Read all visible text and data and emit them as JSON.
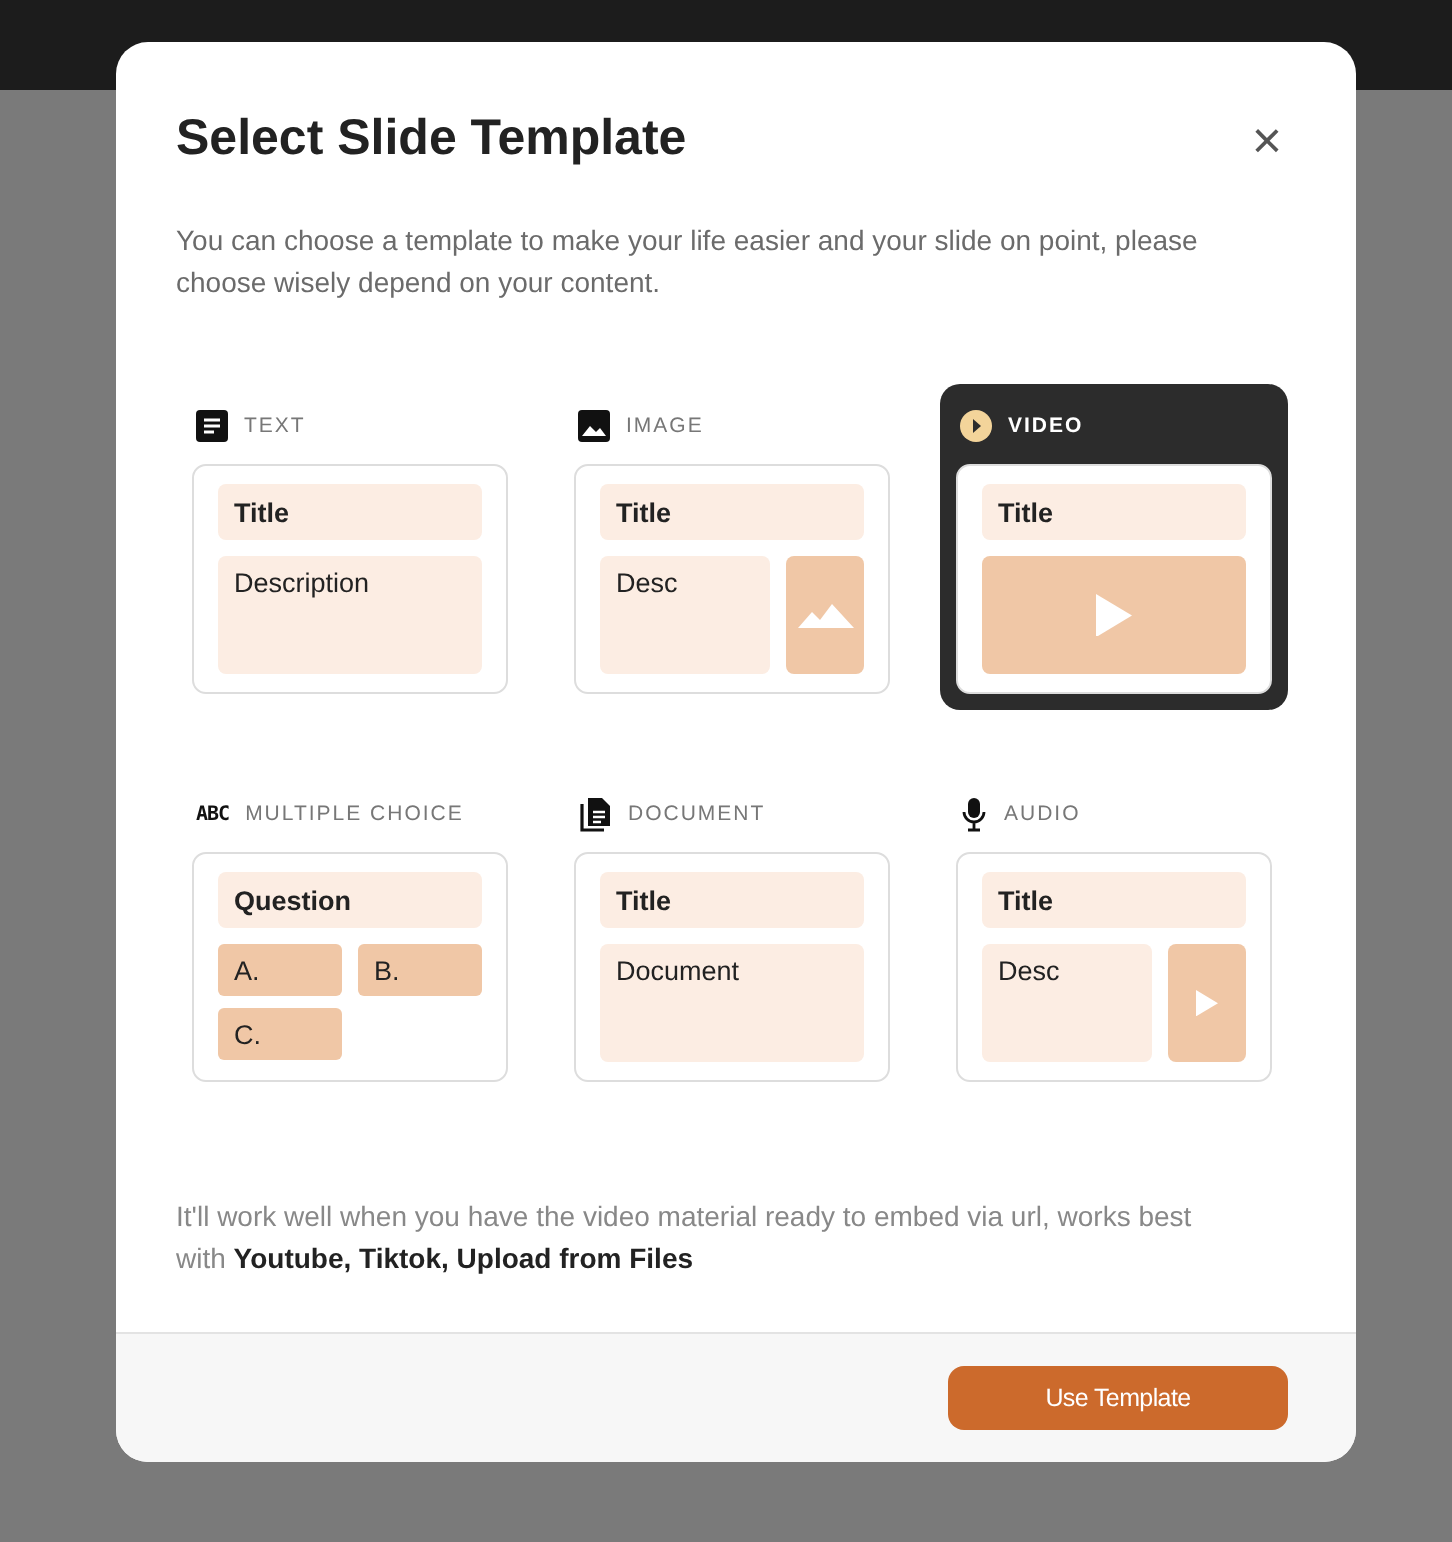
{
  "dialog": {
    "title": "Select Slide Template",
    "close": "×",
    "intro": "You can choose a template to make your life easier and your slide on point, please choose wisely depend on your content.",
    "templates": [
      {
        "kind": "text",
        "label": "TEXT",
        "selected": false,
        "title": "Title",
        "body": "Description"
      },
      {
        "kind": "image",
        "label": "IMAGE",
        "selected": false,
        "title": "Title",
        "body": "Desc"
      },
      {
        "kind": "video",
        "label": "VIDEO",
        "selected": true,
        "title": "Title"
      },
      {
        "kind": "choice",
        "label": "MULTIPLE CHOICE",
        "icon_text": "ABC",
        "selected": false,
        "title": "Question",
        "options": [
          "A.",
          "B.",
          "C."
        ]
      },
      {
        "kind": "document",
        "label": "DOCUMENT",
        "selected": false,
        "title": "Title",
        "body": "Document"
      },
      {
        "kind": "audio",
        "label": "AUDIO",
        "selected": false,
        "title": "Title",
        "body": "Desc"
      }
    ],
    "hint": "It'll work well when you have the video material ready to embed via url, works best with **Youtube, Tiktok, Upload from Files**",
    "button": "Use Template"
  }
}
